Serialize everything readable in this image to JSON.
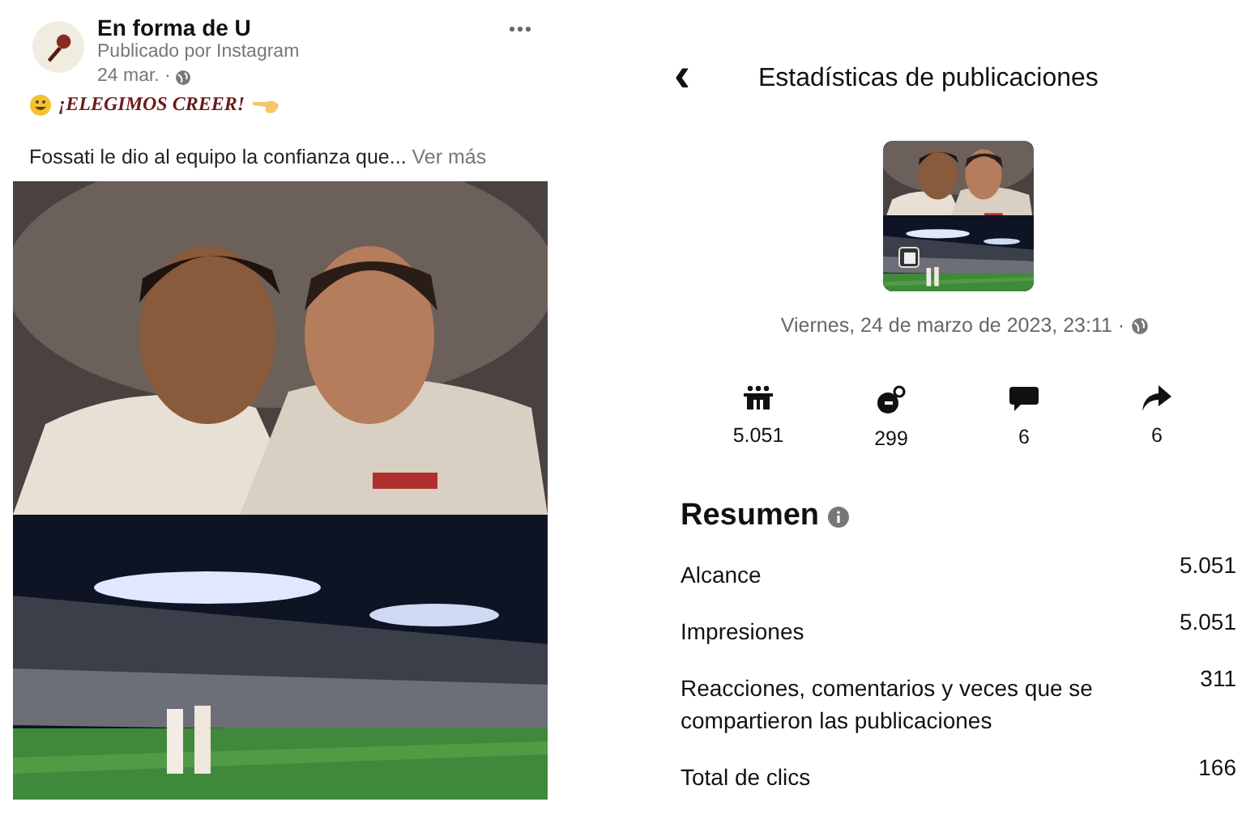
{
  "post": {
    "page_name": "En forma de U",
    "source": "Publicado por Instagram",
    "date": "24 mar. ·",
    "headline": "¡ELEGIMOS CREER!",
    "text": "Fossati le dio al equipo la confianza que...",
    "more_link": "Ver más"
  },
  "stats": {
    "back": "‹",
    "title": "Estadísticas de publicaciones",
    "date": "Viernes, 24 de marzo de 2023, 23:11 ·",
    "metrics": [
      {
        "kind": "reach",
        "value": "5.051"
      },
      {
        "kind": "reactions",
        "value": "299"
      },
      {
        "kind": "comments",
        "value": "6"
      },
      {
        "kind": "shares",
        "value": "6"
      }
    ],
    "summary_title": "Resumen",
    "summary": [
      {
        "label": "Alcance",
        "value": "5.051"
      },
      {
        "label": "Impresiones",
        "value": "5.051"
      },
      {
        "label": "Reacciones, comentarios y veces que se compartieron las publicaciones",
        "value": "311"
      },
      {
        "label": "Total de clics",
        "value": "166"
      }
    ]
  }
}
